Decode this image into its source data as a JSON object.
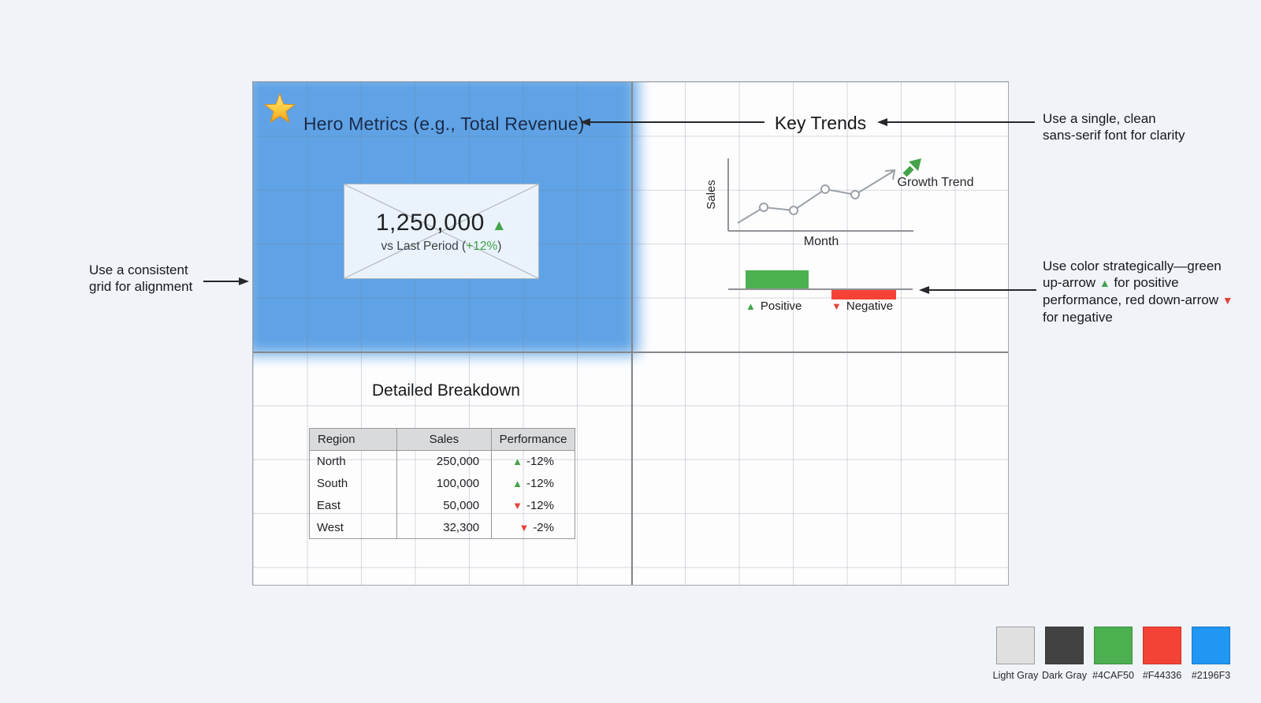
{
  "hero": {
    "title": "Hero Metrics (e.g., Total Revenue)",
    "value": "1,250,000",
    "up_glyph": "▲",
    "subtitle_pre": "vs Last Period (",
    "subtitle_delta": "+12%",
    "subtitle_post": ")",
    "badge_icon": "star"
  },
  "key_trends": {
    "title": "Key Trends",
    "y_axis_label": "Sales",
    "x_axis_label": "Month",
    "trend_label": "Growth Trend",
    "trend_points_relative": [
      [
        45,
        92
      ],
      [
        78,
        72
      ],
      [
        116,
        76
      ],
      [
        156,
        49
      ],
      [
        194,
        56
      ],
      [
        243,
        26
      ]
    ],
    "bars": {
      "positive_direction": "above baseline",
      "negative_direction": "below baseline"
    },
    "legend": {
      "up_glyph": "▲",
      "positive_label": "Positive",
      "down_glyph": "▼",
      "negative_label": "Negative"
    }
  },
  "breakdown": {
    "title": "Detailed Breakdown",
    "columns": [
      "Region",
      "Sales",
      "Performance"
    ],
    "rows": [
      {
        "region": "North",
        "sales": "250,000",
        "perf": "-12%",
        "dir": "up"
      },
      {
        "region": "South",
        "sales": "100,000",
        "perf": "-12%",
        "dir": "up"
      },
      {
        "region": "East",
        "sales": "50,000",
        "perf": "-12%",
        "dir": "down"
      },
      {
        "region": "West",
        "sales": "32,300",
        "perf": "-2%",
        "dir": "down"
      }
    ],
    "up_glyph": "▲",
    "down_glyph": "▼"
  },
  "annotations": {
    "font_note_line1": "Use a single, clean",
    "font_note_line2": "sans-serif font for clarity",
    "grid_note_line1": "Use a consistent",
    "grid_note_line2": "grid for alignment",
    "color_note_part1": "Use color strategically—green up-arrow ",
    "color_note_up_glyph": "▲",
    "color_note_part2": " for positive performance, red down-arrow ",
    "color_note_down_glyph": "▼",
    "color_note_part3": " for negative"
  },
  "palette_swatches": [
    {
      "label": "Light Gray",
      "color": "#E0E0E0"
    },
    {
      "label": "Dark Gray",
      "color": "#424242"
    },
    {
      "label": "#4CAF50",
      "color": "#4CAF50"
    },
    {
      "label": "#F44336",
      "color": "#F44336"
    },
    {
      "label": "#2196F3",
      "color": "#2196F3"
    }
  ],
  "colors": {
    "positive_green": "#4CAF50",
    "negative_red": "#F44336",
    "accent_blue": "#2196F3",
    "hero_region_blue": "#5FA3E6"
  }
}
